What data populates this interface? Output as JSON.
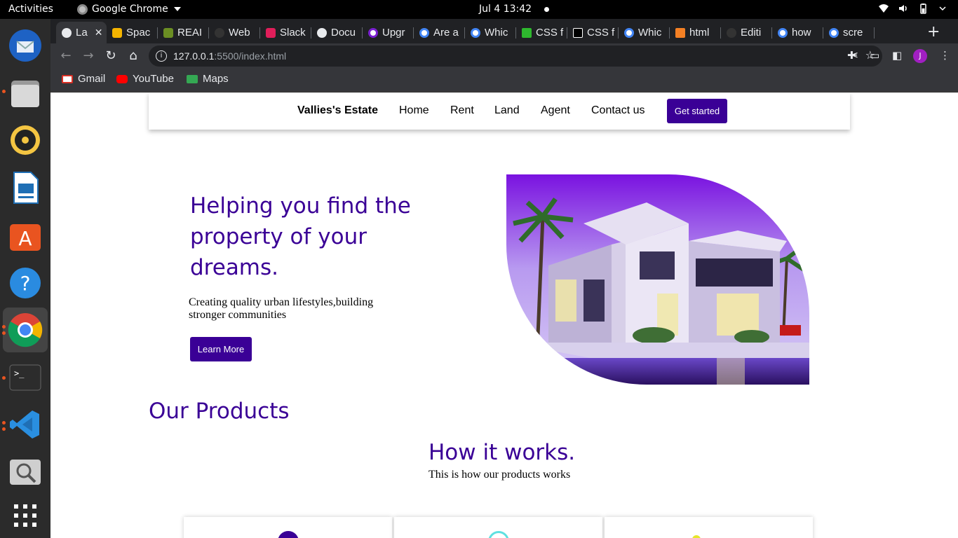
{
  "system": {
    "activities": "Activities",
    "app_name": "Google Chrome",
    "clock": "Jul 4  13:42"
  },
  "browser": {
    "tabs": [
      {
        "label": "La",
        "active": true
      },
      {
        "label": "Spac"
      },
      {
        "label": "REAI"
      },
      {
        "label": "Web"
      },
      {
        "label": "Slack"
      },
      {
        "label": "Docu"
      },
      {
        "label": "Upgr"
      },
      {
        "label": "Are a"
      },
      {
        "label": "Whic"
      },
      {
        "label": "CSS f"
      },
      {
        "label": "CSS f"
      },
      {
        "label": "Whic"
      },
      {
        "label": "html"
      },
      {
        "label": "Editi"
      },
      {
        "label": "how"
      },
      {
        "label": "scre"
      }
    ],
    "new_tab": "+",
    "url_host": "127.0.0.1",
    "url_path": ":5500/index.html",
    "profile_initial": "J",
    "bookmarks": [
      {
        "label": "Gmail"
      },
      {
        "label": "YouTube"
      },
      {
        "label": "Maps"
      }
    ]
  },
  "page": {
    "nav": {
      "brand": "Vallies's Estate",
      "links": [
        "Home",
        "Rent",
        "Land",
        "Agent",
        "Contact us"
      ],
      "cta": "Get started"
    },
    "hero": {
      "title": "Helping you find the property of your dreams.",
      "subtitle": "Creating quality urban lifestyles,building stronger communities",
      "button": "Learn More"
    },
    "products_title": "Our Products",
    "how_title": "How it works.",
    "how_subtitle": "This is how our products works"
  },
  "colors": {
    "accent": "#3a0096",
    "chrome_dark": "#202124",
    "chrome_toolbar": "#35363a"
  }
}
